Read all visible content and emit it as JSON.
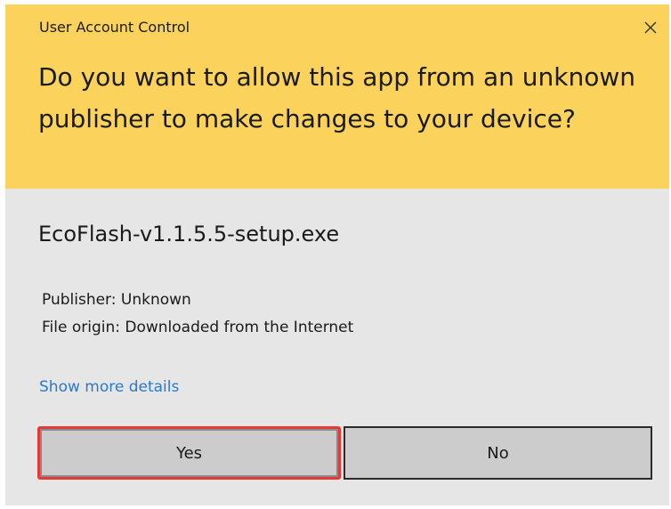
{
  "dialog": {
    "title": "User Account Control",
    "close_icon": "close-icon",
    "question": "Do you want to allow this app from an unknown publisher to make changes to your device?",
    "app_name": "EcoFlash-v1.1.5.5-setup.exe",
    "publisher": "Publisher: Unknown",
    "file_origin": "File origin: Downloaded from the Internet",
    "more_details": "Show more details",
    "yes_label": "Yes",
    "no_label": "No"
  },
  "colors": {
    "header_bg": "#fbd35c",
    "body_bg": "#e6e6e6",
    "link": "#2a7ac8",
    "button_bg": "#cccccc",
    "highlight": "#e53935"
  }
}
